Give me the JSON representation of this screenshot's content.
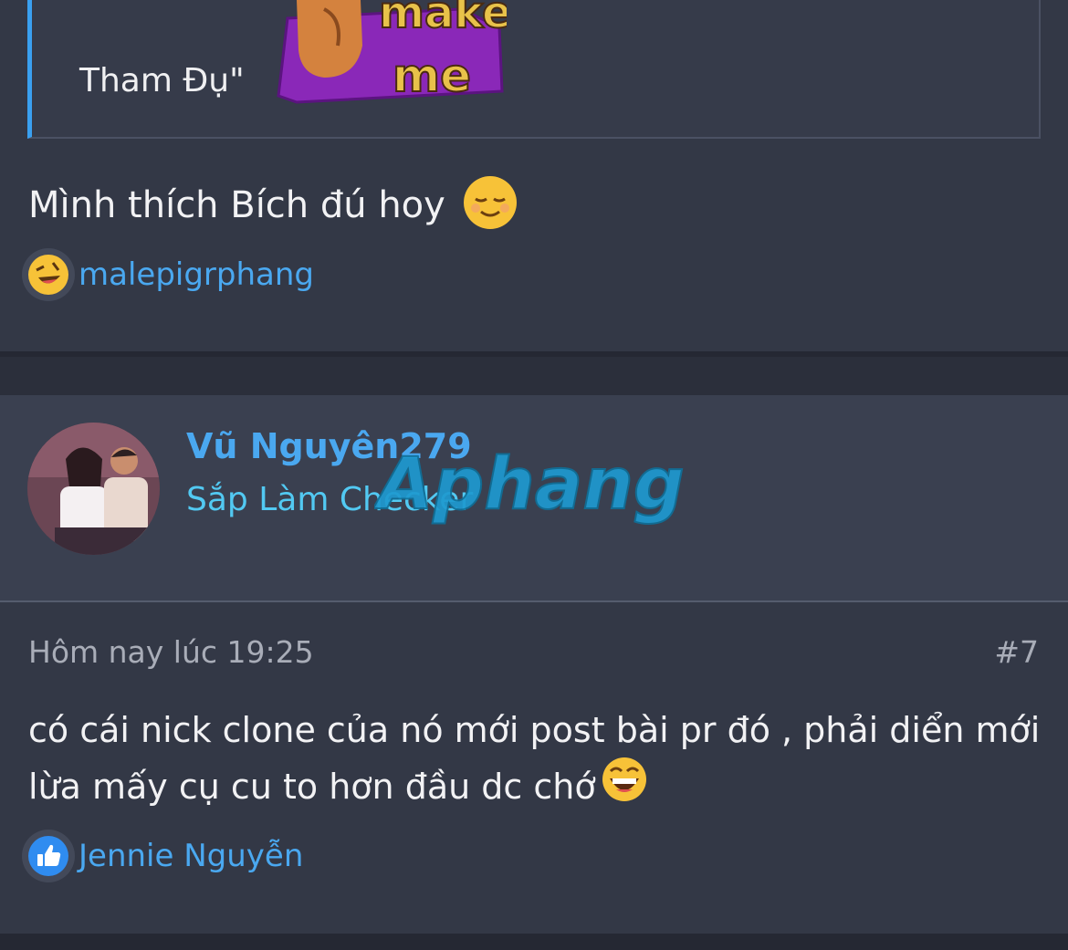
{
  "post_a": {
    "quote_text": "Tham Đụ\"",
    "sticker_text_line1": "make",
    "sticker_text_line2": "me",
    "body": "Mình thích Bích đú hoy",
    "reaction": {
      "type": "rofl",
      "user": "malepigrphang"
    }
  },
  "post_b": {
    "username": "Vũ Nguyên279",
    "user_title": "Sắp Làm Checker",
    "watermark": "Aphang",
    "timestamp": "Hôm nay lúc 19:25",
    "post_number": "#7",
    "body_line1": "có cái nick clone của nó mới post bài pr đó , phải diển mới",
    "body_line2": "lừa mấy cụ cu to hơn đầu dc chớ",
    "reaction": {
      "type": "like",
      "user": "Jennie Nguyễn"
    }
  },
  "colors": {
    "background": "#2b2f3b",
    "post_bg": "#333846",
    "header_bg": "#3a4050",
    "link_blue": "#4aa8f0",
    "title_cyan": "#52c9f2",
    "quote_border": "#3aa0f0"
  }
}
